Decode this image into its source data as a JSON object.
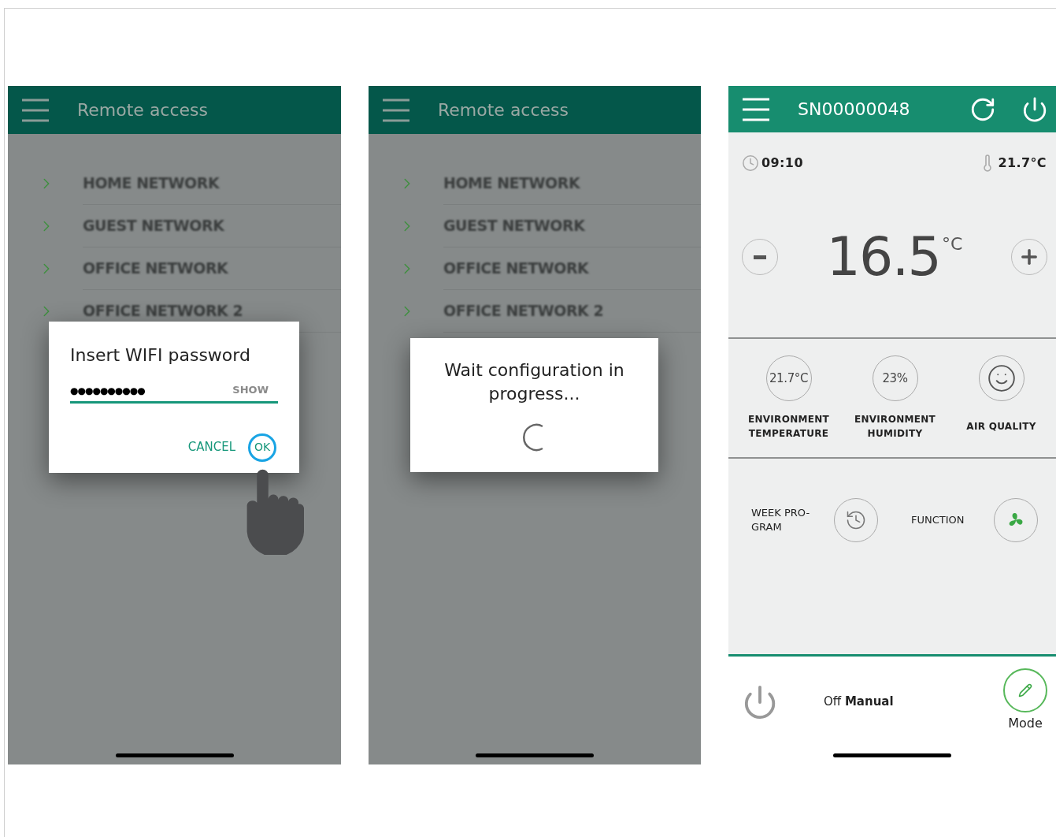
{
  "password_screen": {
    "header": {
      "title": "Remote access"
    },
    "networks": [
      "HOME NETWORK",
      "GUEST NETWORK",
      "OFFICE NETWORK",
      "OFFICE NETWORK 2"
    ],
    "dialog": {
      "title": "Insert WIFI password",
      "value": "●●●●●●●●●●",
      "show_label": "SHOW",
      "cancel_label": "CANCEL",
      "ok_label": "OK"
    }
  },
  "progress_screen": {
    "header": {
      "title": "Remote access"
    },
    "networks": [
      "HOME NETWORK",
      "GUEST NETWORK",
      "OFFICE NETWORK",
      "OFFICE NETWORK 2"
    ],
    "dialog": {
      "message": "Wait configuration in progress..."
    }
  },
  "device_screen": {
    "header": {
      "title": "SN00000048"
    },
    "time": "09:10",
    "room_temperature": "21.7°C",
    "setpoint": "16.5",
    "setpoint_unit": "°C",
    "readings": [
      {
        "kind": "value",
        "value": "21.7°C",
        "label": "ENVIRONMENT TEMPERATURE"
      },
      {
        "kind": "value",
        "value": "23%",
        "label": "ENVIRONMENT HUMIDITY"
      },
      {
        "kind": "face",
        "label": "AIR QUALITY"
      }
    ],
    "shortcuts": [
      {
        "kind": "schedule",
        "label": "WEEK PRO-GRAM"
      },
      {
        "kind": "fan",
        "label": "FUNCTION"
      }
    ],
    "status": {
      "power": "Off",
      "mode": "Manual"
    },
    "mode_button": {
      "label": "Mode"
    }
  }
}
